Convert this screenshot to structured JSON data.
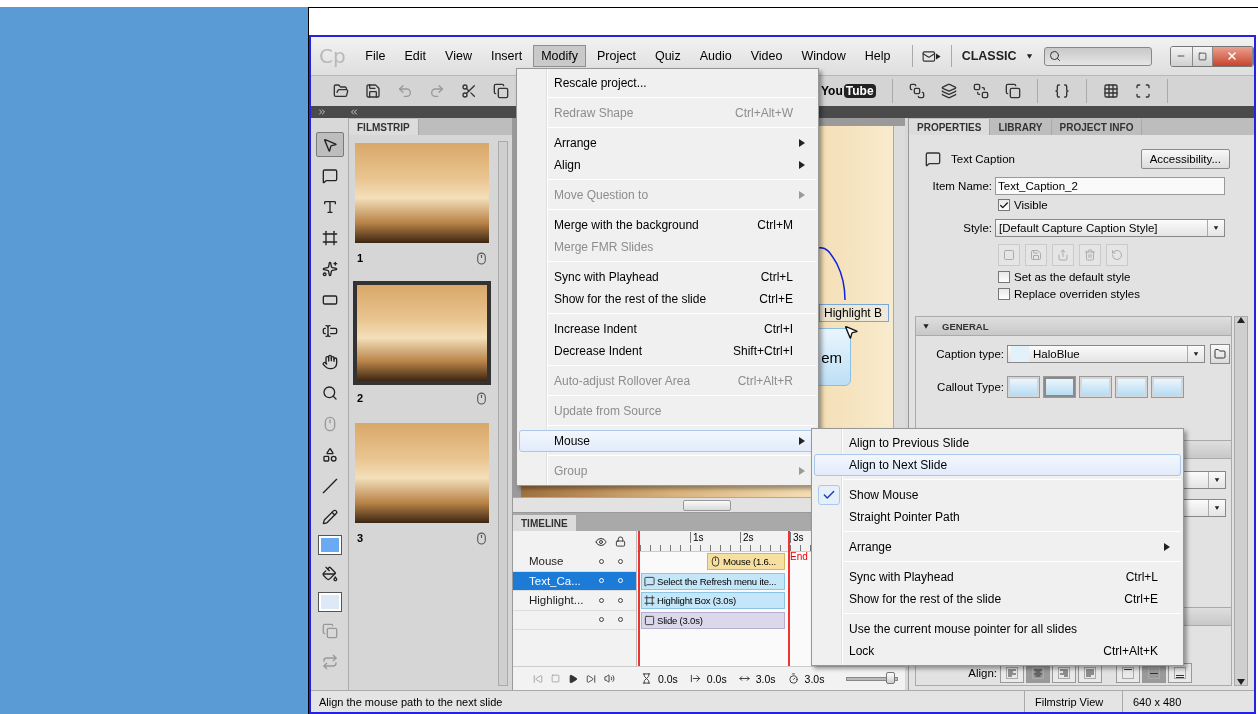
{
  "app": {
    "logo": "Cp",
    "menu_bar": [
      {
        "label": "File",
        "selected": false
      },
      {
        "label": "Edit",
        "selected": false
      },
      {
        "label": "View",
        "selected": false
      },
      {
        "label": "Insert",
        "selected": false
      },
      {
        "label": "Modify",
        "selected": true
      },
      {
        "label": "Project",
        "selected": false
      },
      {
        "label": "Quiz",
        "selected": false
      },
      {
        "label": "Audio",
        "selected": false
      },
      {
        "label": "Video",
        "selected": false
      },
      {
        "label": "Window",
        "selected": false
      },
      {
        "label": "Help",
        "selected": false
      }
    ],
    "workspace": "CLASSIC",
    "toolbar": {
      "publish_logo": [
        "You",
        "Tube"
      ]
    },
    "tools": [
      {
        "kind": "pointer",
        "selected": true,
        "disabled": false
      },
      {
        "kind": "caption",
        "selected": false,
        "disabled": false
      },
      {
        "kind": "rollover-caption",
        "selected": false,
        "disabled": false
      },
      {
        "kind": "highlight",
        "selected": false,
        "disabled": false
      },
      {
        "kind": "click",
        "selected": false,
        "disabled": false
      },
      {
        "kind": "button",
        "selected": false,
        "disabled": false
      },
      {
        "kind": "text-entry",
        "selected": false,
        "disabled": false
      },
      {
        "kind": "rollover-area",
        "selected": false,
        "disabled": false
      },
      {
        "kind": "zoom",
        "selected": false,
        "disabled": false
      },
      {
        "kind": "mouse",
        "selected": false,
        "disabled": true
      },
      {
        "kind": "smart-shape",
        "selected": false,
        "disabled": false
      },
      {
        "kind": "line",
        "selected": false,
        "disabled": false
      },
      {
        "kind": "pencil",
        "selected": false,
        "disabled": false
      },
      {
        "kind": "stroke-swatch",
        "selected": false,
        "disabled": false
      },
      {
        "kind": "fill",
        "selected": false,
        "disabled": false
      },
      {
        "kind": "fill-swatch",
        "selected": false,
        "disabled": false
      },
      {
        "kind": "copy-style",
        "selected": false,
        "disabled": true
      },
      {
        "kind": "swap",
        "selected": false,
        "disabled": true
      }
    ],
    "filmstrip": {
      "title": "FILMSTRIP",
      "slides": [
        {
          "number": "1",
          "selected": false
        },
        {
          "number": "2",
          "selected": true
        },
        {
          "number": "3",
          "selected": false
        }
      ]
    },
    "stage": {
      "highlight_box": "Highlight B",
      "caption": "em"
    },
    "timeline": {
      "title": "TIMELINE",
      "layers": [
        {
          "name": "Mouse",
          "selected": false
        },
        {
          "name": "Text_Ca...",
          "selected": true
        },
        {
          "name": "Highlight...",
          "selected": false
        },
        {
          "selected": false
        }
      ],
      "ruler": [
        "1s",
        "2s",
        "3s"
      ],
      "end_label": "End",
      "bars": [
        {
          "kind": "mouse",
          "label": "Mouse (1.6..."
        },
        {
          "kind": "caption",
          "label": "Select the Refresh menu ite..."
        },
        {
          "kind": "highlight",
          "label": "Highlight Box (3.0s)"
        },
        {
          "kind": "slide",
          "label": "Slide (3.0s)"
        }
      ],
      "readouts": [
        "0.0s",
        "0.0s",
        "3.0s",
        "3.0s"
      ],
      "zoom_slider": {
        "level": 0.88
      }
    },
    "properties": {
      "tabs": [
        {
          "label": "PROPERTIES",
          "selected": true
        },
        {
          "label": "LIBRARY",
          "selected": false
        },
        {
          "label": "PROJECT INFO",
          "selected": false
        }
      ],
      "object_type": "Text Caption",
      "accessibility": "Accessibility...",
      "item_name_label": "Item Name:",
      "item_name": "Text_Caption_2",
      "visible": {
        "label": "Visible",
        "checked": true
      },
      "style_label": "Style:",
      "style": "[Default Capture Caption Style]",
      "style_options": [
        {
          "label": "Set as the default style",
          "checked": false
        },
        {
          "label": "Replace overriden styles",
          "checked": false
        }
      ],
      "general": {
        "title": "GENERAL",
        "expanded": true,
        "caption_type_label": "Caption type:",
        "caption_type": "HaloBlue",
        "callout_label": "Callout Type:",
        "callouts": [
          {
            "selected": false
          },
          {
            "selected": true
          },
          {
            "selected": false
          },
          {
            "selected": false
          },
          {
            "selected": false
          }
        ]
      },
      "align_label": "Align:",
      "align_buttons": [
        {
          "kind": "left",
          "selected": false
        },
        {
          "kind": "center",
          "selected": true
        },
        {
          "kind": "right",
          "selected": false
        },
        {
          "kind": "justify",
          "selected": false
        },
        {
          "kind": "top",
          "selected": false
        },
        {
          "kind": "middle",
          "selected": true
        },
        {
          "kind": "bottom",
          "selected": false
        }
      ]
    },
    "status_bar": {
      "message": "Align the mouse path to the next slide",
      "view": "Filmstrip View",
      "size": "640 x 480"
    }
  },
  "modify_menu": {
    "groups": [
      [
        {
          "label": "Rescale project...",
          "disabled": false,
          "submenu": false,
          "selected": false
        }
      ],
      [
        {
          "label": "Redraw Shape",
          "shortcut": "Ctrl+Alt+W",
          "disabled": true,
          "submenu": false,
          "selected": false
        }
      ],
      [
        {
          "label": "Arrange",
          "disabled": false,
          "submenu": true,
          "selected": false
        },
        {
          "label": "Align",
          "disabled": false,
          "submenu": true,
          "selected": false
        }
      ],
      [
        {
          "label": "Move Question to",
          "disabled": true,
          "submenu": true,
          "selected": false
        }
      ],
      [
        {
          "label": "Merge with the background",
          "shortcut": "Ctrl+M",
          "disabled": false,
          "submenu": false,
          "selected": false
        },
        {
          "label": "Merge FMR Slides",
          "disabled": true,
          "submenu": false,
          "selected": false
        }
      ],
      [
        {
          "label": "Sync with Playhead",
          "shortcut": "Ctrl+L",
          "disabled": false,
          "submenu": false,
          "selected": false
        },
        {
          "label": "Show for the rest of the slide",
          "shortcut": "Ctrl+E",
          "disabled": false,
          "submenu": false,
          "selected": false
        }
      ],
      [
        {
          "label": "Increase Indent",
          "shortcut": "Ctrl+I",
          "disabled": false,
          "submenu": false,
          "selected": false
        },
        {
          "label": "Decrease Indent",
          "shortcut": "Shift+Ctrl+I",
          "disabled": false,
          "submenu": false,
          "selected": false
        }
      ],
      [
        {
          "label": "Auto-adjust Rollover Area",
          "shortcut": "Ctrl+Alt+R",
          "disabled": true,
          "submenu": false,
          "selected": false
        }
      ],
      [
        {
          "label": "Update from Source",
          "disabled": true,
          "submenu": false,
          "selected": false
        }
      ],
      [
        {
          "label": "Mouse",
          "disabled": false,
          "submenu": true,
          "selected": true
        }
      ],
      [
        {
          "label": "Group",
          "disabled": true,
          "submenu": true,
          "selected": false
        }
      ]
    ]
  },
  "mouse_submenu": {
    "groups": [
      [
        {
          "label": "Align to Previous Slide",
          "disabled": false,
          "submenu": false,
          "selected": false,
          "checked": false
        },
        {
          "label": "Align to Next Slide",
          "disabled": false,
          "submenu": false,
          "selected": true,
          "checked": false
        }
      ],
      [
        {
          "label": "Show Mouse",
          "disabled": false,
          "submenu": false,
          "selected": false,
          "checked": true
        },
        {
          "label": "Straight Pointer Path",
          "disabled": false,
          "submenu": false,
          "selected": false,
          "checked": false
        }
      ],
      [
        {
          "label": "Arrange",
          "disabled": false,
          "submenu": true,
          "selected": false,
          "checked": false
        }
      ],
      [
        {
          "label": "Sync with Playhead",
          "shortcut": "Ctrl+L",
          "disabled": false,
          "submenu": false,
          "selected": false,
          "checked": false
        },
        {
          "label": "Show for the rest of the slide",
          "shortcut": "Ctrl+E",
          "disabled": false,
          "submenu": false,
          "selected": false,
          "checked": false
        }
      ],
      [
        {
          "label": "Use the current mouse pointer for all slides",
          "disabled": false,
          "submenu": false,
          "selected": false,
          "checked": false
        },
        {
          "label": "Lock",
          "shortcut": "Ctrl+Alt+K",
          "disabled": false,
          "submenu": false,
          "selected": false,
          "checked": false
        }
      ]
    ]
  }
}
